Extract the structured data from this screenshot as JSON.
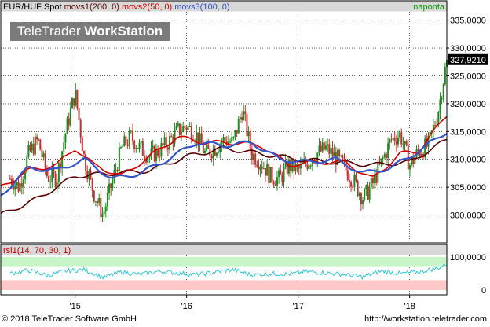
{
  "chart_data": [
    {
      "type": "line",
      "instrument": "EUR/HUF Spot",
      "legend": [
        {
          "name": "movs1(200, 0)",
          "color": "#5a0000"
        },
        {
          "name": "movs2(50, 0)",
          "color": "#d40000"
        },
        {
          "name": "movs3(100, 0)",
          "color": "#3355cc"
        }
      ],
      "period_label": "naponta",
      "last_value_label": "327,9210",
      "yticks": [
        "300,0000",
        "305,0000",
        "310,0000",
        "315,0000",
        "320,0000",
        "325,0000",
        "330,0000",
        "335,0000"
      ],
      "ylim": [
        295,
        336.5
      ],
      "xticks": [
        "'15",
        "'16",
        "'17",
        "'18"
      ],
      "x_range": [
        "2014-05",
        "2018-05"
      ],
      "grid": true,
      "series": [
        {
          "name": "EUR/HUF Spot",
          "x": [
            "2014-06",
            "2014-07",
            "2014-08",
            "2014-09",
            "2014-10",
            "2014-11",
            "2014-12",
            "2015-01",
            "2015-02",
            "2015-03",
            "2015-04",
            "2015-05",
            "2015-06",
            "2015-07",
            "2015-08",
            "2015-09",
            "2015-10",
            "2015-11",
            "2015-12",
            "2016-01",
            "2016-02",
            "2016-03",
            "2016-04",
            "2016-05",
            "2016-06",
            "2016-07",
            "2016-08",
            "2016-09",
            "2016-10",
            "2016-11",
            "2016-12",
            "2017-01",
            "2017-02",
            "2017-03",
            "2017-04",
            "2017-05",
            "2017-06",
            "2017-07",
            "2017-08",
            "2017-09",
            "2017-10",
            "2017-11",
            "2017-12",
            "2018-01",
            "2018-02",
            "2018-03",
            "2018-04",
            "2018-05"
          ],
          "y": [
            306.5,
            305.0,
            311.0,
            313.5,
            307.0,
            306.5,
            315.0,
            322.0,
            310.0,
            304.0,
            300.0,
            306.0,
            312.0,
            314.0,
            312.0,
            310.5,
            311.5,
            313.0,
            315.0,
            316.0,
            314.5,
            311.0,
            312.0,
            313.5,
            313.0,
            319.0,
            311.0,
            309.5,
            307.0,
            306.5,
            309.0,
            308.0,
            309.5,
            311.0,
            312.0,
            310.5,
            308.5,
            306.0,
            303.0,
            305.5,
            309.5,
            313.5,
            314.5,
            309.0,
            311.5,
            312.5,
            318.0,
            327.9
          ]
        },
        {
          "name": "movs1(200, 0)",
          "x": [
            "2014-05",
            "2014-09",
            "2015-01",
            "2015-05",
            "2015-09",
            "2016-01",
            "2016-05",
            "2016-09",
            "2017-01",
            "2017-05",
            "2017-09",
            "2018-01",
            "2018-05"
          ],
          "y": [
            300.0,
            303.0,
            307.0,
            307.5,
            308.0,
            310.5,
            312.0,
            311.0,
            310.0,
            309.5,
            309.0,
            309.5,
            313.5
          ]
        },
        {
          "name": "movs2(50, 0)",
          "x": [
            "2014-05",
            "2014-08",
            "2014-11",
            "2015-01",
            "2015-03",
            "2015-06",
            "2015-09",
            "2015-12",
            "2016-03",
            "2016-06",
            "2016-09",
            "2016-12",
            "2017-03",
            "2017-06",
            "2017-09",
            "2017-12",
            "2018-02",
            "2018-05"
          ],
          "y": [
            305.0,
            308.0,
            309.0,
            312.0,
            309.0,
            307.0,
            310.5,
            314.0,
            313.0,
            313.0,
            312.5,
            309.0,
            309.5,
            309.5,
            306.5,
            311.0,
            311.5,
            318.0
          ]
        },
        {
          "name": "movs3(100, 0)",
          "x": [
            "2014-05",
            "2014-08",
            "2014-11",
            "2015-02",
            "2015-05",
            "2015-08",
            "2015-11",
            "2016-02",
            "2016-05",
            "2016-08",
            "2016-11",
            "2017-02",
            "2017-05",
            "2017-08",
            "2017-11",
            "2018-02",
            "2018-05"
          ],
          "y": [
            303.5,
            308.5,
            308.0,
            310.0,
            306.5,
            307.5,
            310.0,
            313.0,
            312.5,
            313.0,
            310.0,
            309.5,
            310.0,
            307.5,
            308.5,
            311.5,
            315.0
          ]
        }
      ]
    },
    {
      "type": "line",
      "legend_label": "rsi1(14, 70, 30, 1)",
      "yticks": [
        "0",
        "100,0000"
      ],
      "ylim": [
        0,
        100
      ],
      "bands": {
        "upper": [
          70,
          100
        ],
        "lower": [
          0,
          30
        ]
      },
      "band_colors": {
        "upper": "#c8f5c8",
        "lower": "#ffc8c8"
      },
      "xticks": [
        "'15",
        "'16",
        "'17",
        "'18"
      ],
      "x_range": [
        "2014-05",
        "2018-05"
      ],
      "series": [
        {
          "name": "rsi1(14, 70, 30, 1)",
          "x": [
            "2014-06",
            "2014-08",
            "2014-10",
            "2014-12",
            "2015-02",
            "2015-04",
            "2015-06",
            "2015-08",
            "2015-10",
            "2015-12",
            "2016-02",
            "2016-04",
            "2016-06",
            "2016-08",
            "2016-10",
            "2016-12",
            "2017-02",
            "2017-04",
            "2017-06",
            "2017-08",
            "2017-10",
            "2017-12",
            "2018-02",
            "2018-04",
            "2018-05"
          ],
          "y": [
            50,
            60,
            44,
            58,
            62,
            38,
            55,
            47,
            57,
            52,
            46,
            54,
            62,
            45,
            50,
            48,
            56,
            52,
            47,
            40,
            58,
            50,
            55,
            66,
            78
          ]
        }
      ]
    }
  ],
  "footer": {
    "copyright": "© 2018 TeleTrader Software GmbH",
    "url": "http://workstation.teletrader.com"
  },
  "watermark": {
    "part1": "TeleTrader ",
    "part2": "WorkStation"
  },
  "colors": {
    "candle_up": "#1e8a1e",
    "candle_down": "#c03030",
    "rsi_line": "#30c8d8",
    "legend_bar": "#d8d8d8"
  }
}
